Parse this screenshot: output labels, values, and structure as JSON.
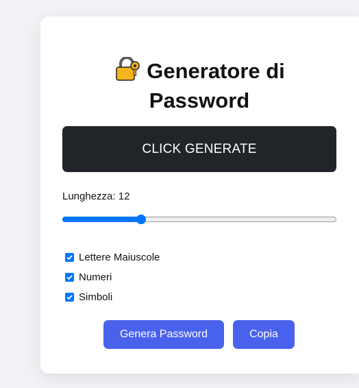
{
  "title": {
    "icon": "lock-with-key-icon",
    "line1": "Generatore di",
    "line2": "Password"
  },
  "display": {
    "text": "CLICK GENERATE"
  },
  "length": {
    "label": "Lunghezza: 12",
    "value": 12,
    "fraction": 0.29
  },
  "options": [
    {
      "label": "Lettere Maiuscole",
      "checked": true
    },
    {
      "label": "Numeri",
      "checked": true
    },
    {
      "label": "Simboli",
      "checked": true
    }
  ],
  "buttons": {
    "generate_label": "Genera Password",
    "copy_label": "Copia"
  },
  "colors": {
    "accent": "#4962ec",
    "slider": "#0075ff",
    "display_bg": "#212529"
  }
}
